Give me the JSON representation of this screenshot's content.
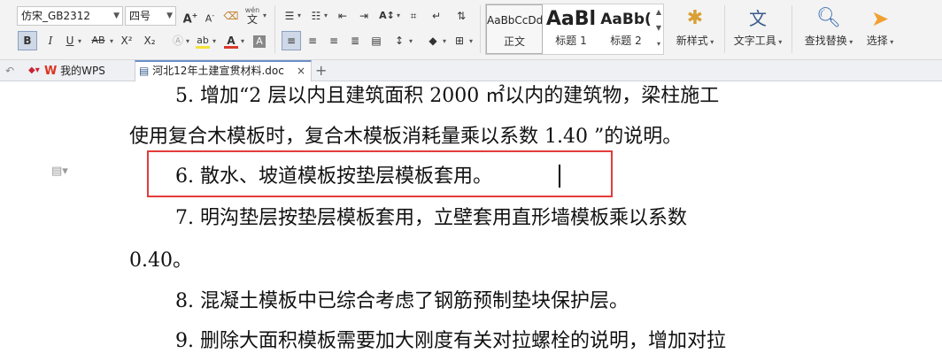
{
  "toolbar": {
    "font_name": "仿宋_GB2312",
    "font_size": "四号",
    "grow_font": "A",
    "shrink_font": "A",
    "bold": "B",
    "italic": "I",
    "underline": "U",
    "strike": "AB",
    "superscript": "X²",
    "subscript": "X₂",
    "highlight_label": "ab",
    "font_color_label": "A",
    "char_shade_label": "A",
    "wen_label": "wén",
    "wen_char": "文",
    "styles": [
      {
        "preview": "AaBbCcDd",
        "label": "正文"
      },
      {
        "preview": "AaBl",
        "label": "标题 1"
      },
      {
        "preview": "AaBb(",
        "label": "标题 2"
      }
    ],
    "new_style_label": "新样式",
    "text_tools_label": "文字工具",
    "find_replace_label": "查找替换",
    "select_label": "选择",
    "colors": {
      "highlight": "#f5e23a",
      "font_color": "#d83a2c",
      "accent": "#6a8fc9",
      "select_arrow": "#f0a030"
    }
  },
  "tabs": [
    {
      "label": "我的WPS"
    },
    {
      "label": "河北12年土建宣贯材料.doc",
      "close": "×"
    }
  ],
  "tab_add": "+",
  "document": {
    "lines": [
      "5. 增加“2 层以内且建筑面积 2000 ㎡以内的建筑物，梁柱施工",
      "使用复合木模板时，复合木模板消耗量乘以系数 1.40 ”的说明。",
      "6. 散水、坡道模板按垫层模板套用。",
      "7. 明沟垫层按垫层模板套用，立壁套用直形墙模板乘以系数",
      "0.40。",
      "8. 混凝土模板中已综合考虑了钢筋预制垫块保护层。",
      "9. 删除大面积模板需要加大刚度有关对拉螺栓的说明，增加对拉"
    ]
  }
}
